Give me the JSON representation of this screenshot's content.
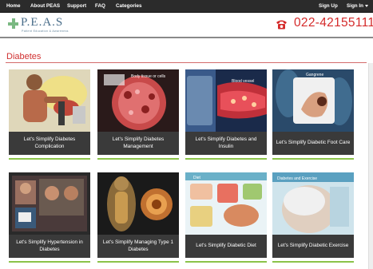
{
  "nav": {
    "items": [
      {
        "label": "Home"
      },
      {
        "label": "About PEAS"
      },
      {
        "label": "Support"
      },
      {
        "label": "FAQ"
      },
      {
        "label": "Categories"
      }
    ],
    "sign_up": "Sign Up",
    "sign_in": "Sign In"
  },
  "header": {
    "logo_text": "P.E.A.S",
    "logo_tagline": "Patient Education & Awareness",
    "phone": "022-42155111"
  },
  "section": {
    "title": "Diabetes"
  },
  "cards": [
    {
      "title": "Let's Simplify Diabetes Complication",
      "thumb_label": ""
    },
    {
      "title": "Let's Simplify Diabetes Management",
      "thumb_label": "Body tissue or cells"
    },
    {
      "title": "Let's Simplify Diabetes and Insulin",
      "thumb_label": "Blood vessel"
    },
    {
      "title": "Let's Simplify Diabetic Foot Care",
      "thumb_label": "Gangrene"
    },
    {
      "title": "Let's Simplify Hypertension in Diabetes",
      "thumb_label": ""
    },
    {
      "title": "Let's Simplify Managing Type 1 Diabetes",
      "thumb_label": ""
    },
    {
      "title": "Let's Simplify Diabetic Diet",
      "thumb_label": "Diet"
    },
    {
      "title": "Let's Simplify Diabetic Exercise",
      "thumb_label": "Diabetes and Exercise"
    }
  ],
  "colors": {
    "accent_red": "#d03030",
    "nav_bg": "#2b2b2b",
    "caption_bg": "#3a3a3a",
    "underline_green": "#8bc34a",
    "logo_green": "#7ab882"
  }
}
